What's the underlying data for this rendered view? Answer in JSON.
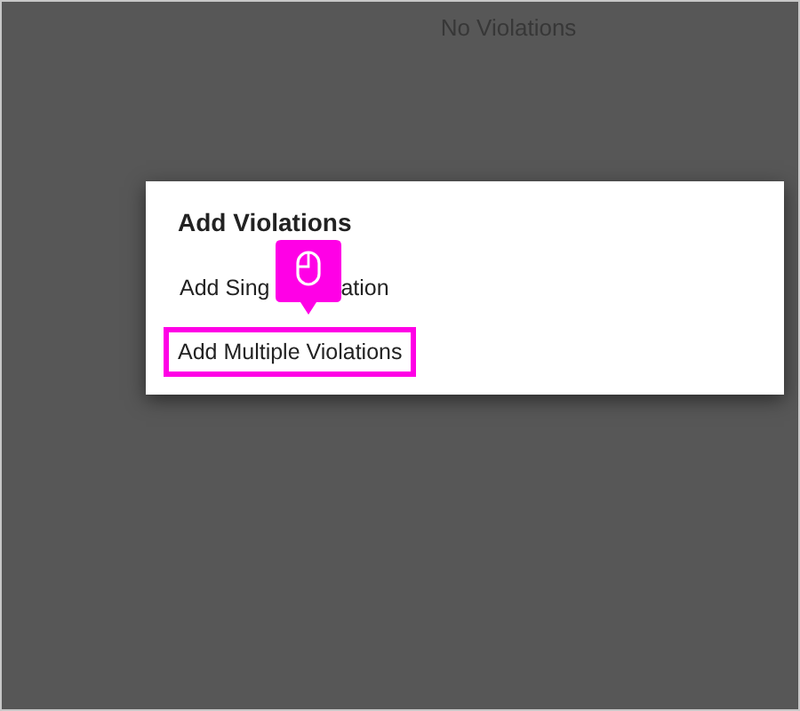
{
  "empty_message": "No Violations",
  "dialog": {
    "title": "Add Violations",
    "options": [
      {
        "parts": [
          "Add Sing",
          "ation"
        ],
        "highlighted": false,
        "cursor": true
      },
      {
        "parts": [
          "Add Multiple Violations"
        ],
        "highlighted": true,
        "cursor": false
      }
    ]
  }
}
